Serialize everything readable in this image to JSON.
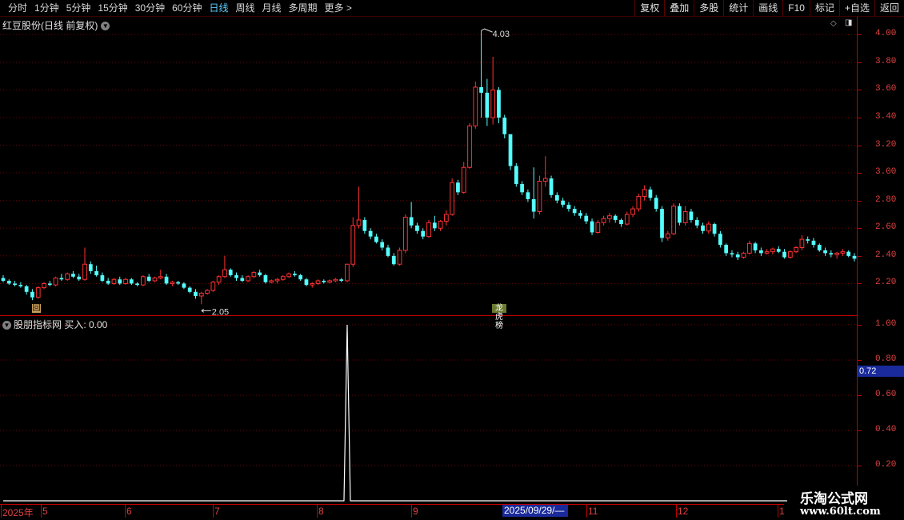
{
  "toolbar": {
    "period_tabs": [
      "分时",
      "1分钟",
      "5分钟",
      "15分钟",
      "30分钟",
      "60分钟",
      "日线",
      "周线",
      "月线",
      "多周期"
    ],
    "active_tab": "日线",
    "more_label": "更多 >",
    "right_buttons": [
      "复权",
      "叠加",
      "多股",
      "统计",
      "画线",
      "F10",
      "标记",
      "+自选",
      "返回"
    ]
  },
  "main_panel": {
    "title": "红豆股份(日线 前复权)",
    "price_ticks": [
      "4.00",
      "3.80",
      "3.60",
      "3.40",
      "3.20",
      "3.00",
      "2.80",
      "2.60",
      "2.40",
      "2.20"
    ],
    "high_marker": "4.03",
    "low_marker": "2.05",
    "event_marker_1": "回",
    "event_marker_2": "龙虎榜"
  },
  "indicator_panel": {
    "title": "股朋指标网  买入: 0.00",
    "ticks": [
      "1.00",
      "0.80",
      "0.60",
      "0.40",
      "0.20"
    ],
    "cursor_value": "0.72"
  },
  "date_axis": {
    "labels": [
      "2025年",
      "5",
      "6",
      "7",
      "8",
      "9",
      "11",
      "12",
      "1"
    ],
    "highlight": "2025/09/29/—"
  },
  "watermark": {
    "title": "乐淘公式网",
    "url": "www.60lt.com"
  },
  "colors": {
    "up": "#ff3232",
    "down": "#54ffff",
    "axis": "#c00000",
    "grid": "#7a0000"
  },
  "chart_data": {
    "type": "candlestick",
    "ylim": [
      2.0,
      4.1
    ],
    "indicator_ylim": [
      0.0,
      1.05
    ],
    "candles": [
      [
        2.24,
        2.26,
        2.21,
        2.22
      ],
      [
        2.22,
        2.23,
        2.19,
        2.2
      ],
      [
        2.2,
        2.22,
        2.18,
        2.19
      ],
      [
        2.19,
        2.21,
        2.17,
        2.18
      ],
      [
        2.18,
        2.19,
        2.12,
        2.14
      ],
      [
        2.14,
        2.16,
        2.08,
        2.1
      ],
      [
        2.1,
        2.18,
        2.09,
        2.17
      ],
      [
        2.17,
        2.21,
        2.16,
        2.2
      ],
      [
        2.2,
        2.22,
        2.18,
        2.19
      ],
      [
        2.19,
        2.25,
        2.18,
        2.24
      ],
      [
        2.24,
        2.27,
        2.22,
        2.23
      ],
      [
        2.23,
        2.28,
        2.22,
        2.27
      ],
      [
        2.27,
        2.29,
        2.24,
        2.25
      ],
      [
        2.25,
        2.27,
        2.22,
        2.23
      ],
      [
        2.23,
        2.46,
        2.22,
        2.34
      ],
      [
        2.34,
        2.36,
        2.27,
        2.29
      ],
      [
        2.29,
        2.33,
        2.25,
        2.26
      ],
      [
        2.26,
        2.28,
        2.21,
        2.22
      ],
      [
        2.22,
        2.24,
        2.19,
        2.2
      ],
      [
        2.2,
        2.24,
        2.19,
        2.23
      ],
      [
        2.23,
        2.25,
        2.19,
        2.2
      ],
      [
        2.2,
        2.24,
        2.19,
        2.23
      ],
      [
        2.23,
        2.24,
        2.19,
        2.2
      ],
      [
        2.2,
        2.21,
        2.18,
        2.19
      ],
      [
        2.19,
        2.26,
        2.18,
        2.25
      ],
      [
        2.25,
        2.27,
        2.21,
        2.22
      ],
      [
        2.22,
        2.25,
        2.21,
        2.24
      ],
      [
        2.24,
        2.3,
        2.23,
        2.25
      ],
      [
        2.25,
        2.27,
        2.19,
        2.2
      ],
      [
        2.2,
        2.22,
        2.18,
        2.21
      ],
      [
        2.21,
        2.22,
        2.19,
        2.2
      ],
      [
        2.2,
        2.21,
        2.16,
        2.17
      ],
      [
        2.17,
        2.18,
        2.13,
        2.14
      ],
      [
        2.14,
        2.16,
        2.09,
        2.11
      ],
      [
        2.11,
        2.14,
        2.05,
        2.13
      ],
      [
        2.13,
        2.16,
        2.12,
        2.15
      ],
      [
        2.15,
        2.22,
        2.14,
        2.21
      ],
      [
        2.21,
        2.26,
        2.19,
        2.25
      ],
      [
        2.25,
        2.4,
        2.24,
        2.3
      ],
      [
        2.3,
        2.31,
        2.25,
        2.26
      ],
      [
        2.26,
        2.28,
        2.22,
        2.24
      ],
      [
        2.24,
        2.26,
        2.21,
        2.22
      ],
      [
        2.22,
        2.26,
        2.21,
        2.25
      ],
      [
        2.25,
        2.29,
        2.24,
        2.28
      ],
      [
        2.28,
        2.3,
        2.25,
        2.26
      ],
      [
        2.26,
        2.27,
        2.2,
        2.21
      ],
      [
        2.21,
        2.23,
        2.2,
        2.22
      ],
      [
        2.22,
        2.24,
        2.2,
        2.23
      ],
      [
        2.23,
        2.26,
        2.22,
        2.25
      ],
      [
        2.25,
        2.28,
        2.24,
        2.27
      ],
      [
        2.27,
        2.29,
        2.25,
        2.26
      ],
      [
        2.26,
        2.27,
        2.22,
        2.23
      ],
      [
        2.23,
        2.24,
        2.18,
        2.19
      ],
      [
        2.19,
        2.21,
        2.17,
        2.2
      ],
      [
        2.2,
        2.23,
        2.19,
        2.22
      ],
      [
        2.22,
        2.23,
        2.2,
        2.21
      ],
      [
        2.21,
        2.23,
        2.2,
        2.22
      ],
      [
        2.22,
        2.24,
        2.21,
        2.23
      ],
      [
        2.23,
        2.24,
        2.21,
        2.22
      ],
      [
        2.22,
        2.34,
        2.21,
        2.34
      ],
      [
        2.34,
        2.68,
        2.32,
        2.62
      ],
      [
        2.62,
        2.9,
        2.6,
        2.66
      ],
      [
        2.66,
        2.68,
        2.56,
        2.58
      ],
      [
        2.58,
        2.6,
        2.52,
        2.54
      ],
      [
        2.54,
        2.56,
        2.49,
        2.5
      ],
      [
        2.5,
        2.52,
        2.44,
        2.46
      ],
      [
        2.46,
        2.48,
        2.39,
        2.4
      ],
      [
        2.4,
        2.42,
        2.33,
        2.34
      ],
      [
        2.34,
        2.46,
        2.33,
        2.44
      ],
      [
        2.44,
        2.7,
        2.42,
        2.68
      ],
      [
        2.68,
        2.79,
        2.6,
        2.62
      ],
      [
        2.62,
        2.64,
        2.56,
        2.58
      ],
      [
        2.58,
        2.6,
        2.52,
        2.54
      ],
      [
        2.54,
        2.66,
        2.53,
        2.64
      ],
      [
        2.64,
        2.69,
        2.58,
        2.6
      ],
      [
        2.6,
        2.66,
        2.58,
        2.65
      ],
      [
        2.65,
        2.73,
        2.62,
        2.7
      ],
      [
        2.7,
        2.96,
        2.69,
        2.93
      ],
      [
        2.93,
        2.95,
        2.84,
        2.86
      ],
      [
        2.86,
        3.08,
        2.85,
        3.04
      ],
      [
        3.04,
        3.36,
        3.03,
        3.34
      ],
      [
        3.34,
        3.66,
        3.32,
        3.62
      ],
      [
        3.62,
        4.03,
        3.4,
        3.58
      ],
      [
        3.58,
        3.68,
        3.34,
        3.4
      ],
      [
        3.4,
        3.84,
        3.35,
        3.6
      ],
      [
        3.6,
        3.62,
        3.36,
        3.4
      ],
      [
        3.4,
        3.42,
        3.25,
        3.28
      ],
      [
        3.28,
        3.1,
        3.02,
        3.05
      ],
      [
        3.05,
        3.07,
        2.9,
        2.92
      ],
      [
        2.92,
        2.94,
        2.84,
        2.86
      ],
      [
        2.86,
        2.88,
        2.79,
        2.81
      ],
      [
        2.81,
        3.04,
        2.67,
        2.72
      ],
      [
        2.72,
        2.98,
        2.7,
        2.94
      ],
      [
        2.94,
        3.12,
        2.9,
        2.96
      ],
      [
        2.96,
        2.98,
        2.82,
        2.84
      ],
      [
        2.84,
        2.86,
        2.78,
        2.8
      ],
      [
        2.8,
        2.82,
        2.75,
        2.77
      ],
      [
        2.77,
        2.79,
        2.72,
        2.74
      ],
      [
        2.74,
        2.76,
        2.69,
        2.71
      ],
      [
        2.71,
        2.73,
        2.67,
        2.69
      ],
      [
        2.69,
        2.71,
        2.63,
        2.65
      ],
      [
        2.65,
        2.67,
        2.55,
        2.57
      ],
      [
        2.57,
        2.66,
        2.56,
        2.64
      ],
      [
        2.64,
        2.69,
        2.62,
        2.67
      ],
      [
        2.67,
        2.71,
        2.64,
        2.69
      ],
      [
        2.69,
        2.7,
        2.64,
        2.66
      ],
      [
        2.66,
        2.67,
        2.61,
        2.63
      ],
      [
        2.63,
        2.72,
        2.62,
        2.7
      ],
      [
        2.7,
        2.76,
        2.68,
        2.74
      ],
      [
        2.74,
        2.85,
        2.72,
        2.83
      ],
      [
        2.83,
        2.91,
        2.8,
        2.88
      ],
      [
        2.88,
        2.9,
        2.8,
        2.82
      ],
      [
        2.82,
        2.84,
        2.72,
        2.74
      ],
      [
        2.74,
        2.76,
        2.5,
        2.53
      ],
      [
        2.53,
        2.58,
        2.51,
        2.56
      ],
      [
        2.56,
        2.78,
        2.55,
        2.76
      ],
      [
        2.76,
        2.78,
        2.62,
        2.64
      ],
      [
        2.64,
        2.76,
        2.62,
        2.72
      ],
      [
        2.72,
        2.74,
        2.64,
        2.66
      ],
      [
        2.66,
        2.68,
        2.6,
        2.62
      ],
      [
        2.62,
        2.64,
        2.56,
        2.58
      ],
      [
        2.58,
        2.65,
        2.56,
        2.63
      ],
      [
        2.63,
        2.64,
        2.54,
        2.56
      ],
      [
        2.56,
        2.58,
        2.46,
        2.48
      ],
      [
        2.48,
        2.49,
        2.4,
        2.42
      ],
      [
        2.42,
        2.44,
        2.39,
        2.41
      ],
      [
        2.41,
        2.43,
        2.37,
        2.39
      ],
      [
        2.39,
        2.43,
        2.38,
        2.42
      ],
      [
        2.42,
        2.51,
        2.41,
        2.49
      ],
      [
        2.49,
        2.5,
        2.42,
        2.44
      ],
      [
        2.44,
        2.46,
        2.4,
        2.42
      ],
      [
        2.42,
        2.45,
        2.41,
        2.43
      ],
      [
        2.43,
        2.46,
        2.41,
        2.45
      ],
      [
        2.45,
        2.47,
        2.42,
        2.43
      ],
      [
        2.43,
        2.45,
        2.38,
        2.39
      ],
      [
        2.39,
        2.44,
        2.38,
        2.43
      ],
      [
        2.43,
        2.47,
        2.42,
        2.46
      ],
      [
        2.46,
        2.55,
        2.44,
        2.52
      ],
      [
        2.52,
        2.54,
        2.49,
        2.51
      ],
      [
        2.51,
        2.53,
        2.46,
        2.48
      ],
      [
        2.48,
        2.49,
        2.43,
        2.44
      ],
      [
        2.44,
        2.46,
        2.4,
        2.42
      ],
      [
        2.42,
        2.44,
        2.39,
        2.41
      ],
      [
        2.41,
        2.43,
        2.38,
        2.42
      ],
      [
        2.42,
        2.45,
        2.4,
        2.43
      ],
      [
        2.43,
        2.44,
        2.39,
        2.4
      ],
      [
        2.4,
        2.42,
        2.36,
        2.38
      ]
    ],
    "indicator_values": [
      0,
      0,
      0,
      0,
      0,
      0,
      0,
      0,
      0,
      0,
      0,
      0,
      0,
      0,
      0,
      0,
      0,
      0,
      0,
      0,
      0,
      0,
      0,
      0,
      0,
      0,
      0,
      0,
      0,
      0,
      0,
      0,
      0,
      0,
      0,
      0,
      0,
      0,
      0,
      0,
      0,
      0,
      0,
      0,
      0,
      0,
      0,
      0,
      0,
      0,
      0,
      0,
      0,
      0,
      0,
      0,
      0,
      0,
      0,
      1.0,
      0,
      0,
      0,
      0,
      0,
      0,
      0,
      0,
      0,
      0,
      0,
      0,
      0,
      0,
      0,
      0,
      0,
      0,
      0,
      0,
      0,
      0,
      0,
      0,
      0,
      0,
      0,
      0,
      0,
      0,
      0,
      0,
      0,
      0,
      0,
      0,
      0,
      0,
      0,
      0,
      0,
      0,
      0,
      0,
      0,
      0,
      0,
      0,
      0,
      0,
      0,
      0,
      0,
      0,
      0,
      0,
      0,
      0,
      0,
      0,
      0,
      0,
      0,
      0,
      0,
      0,
      0,
      0,
      0,
      0,
      0,
      0,
      0,
      0,
      0,
      0,
      0,
      0,
      0,
      0,
      0,
      0,
      0,
      0,
      0,
      0,
      0
    ]
  }
}
